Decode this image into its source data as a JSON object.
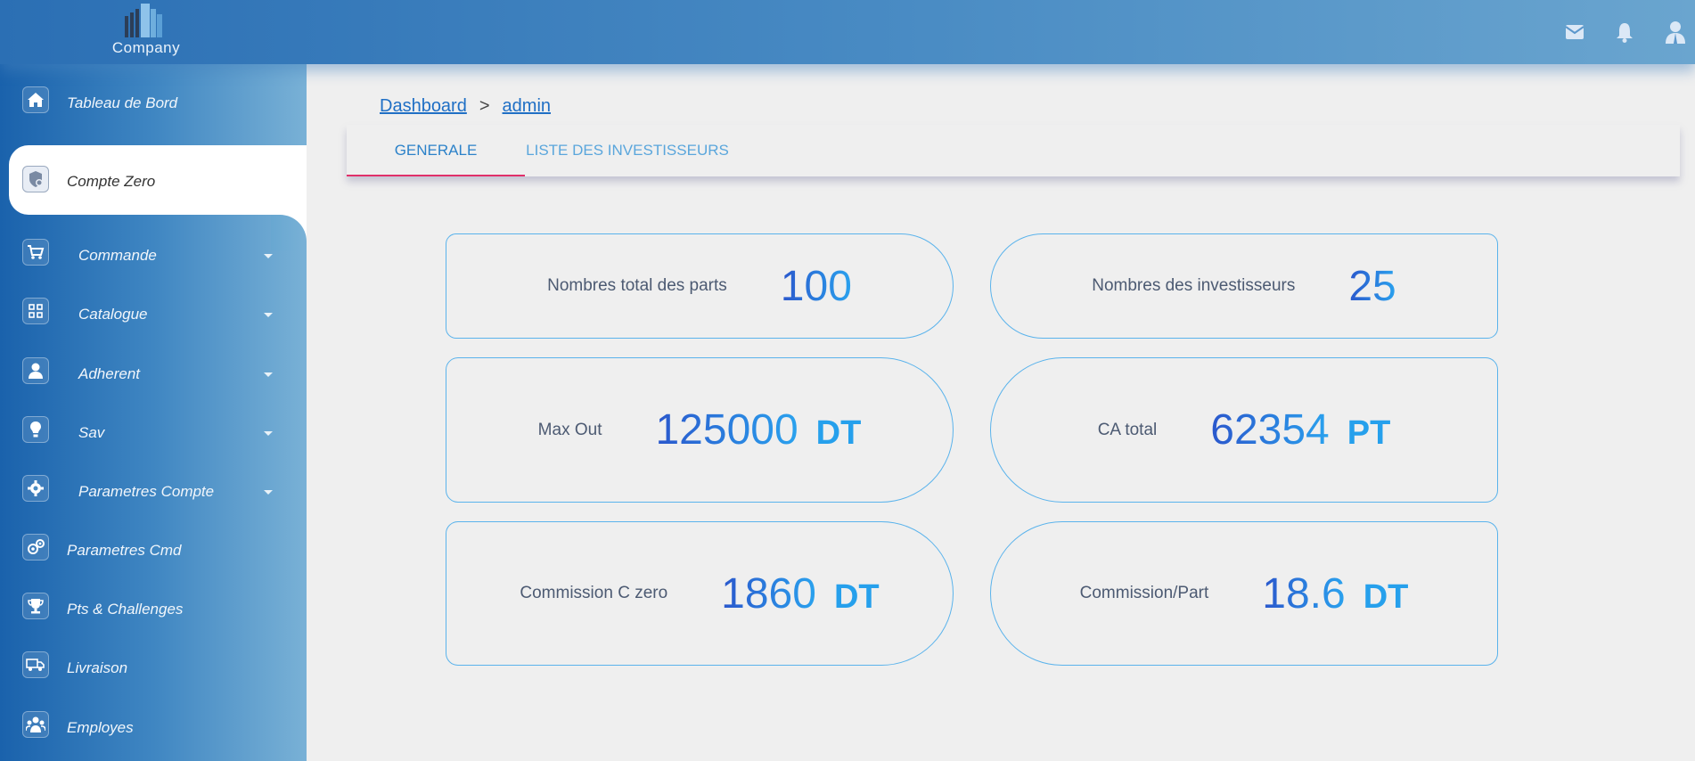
{
  "header": {
    "logo_text": "Company",
    "icons": [
      "mail-icon",
      "bell-icon",
      "user-icon"
    ]
  },
  "sidebar": {
    "items": [
      {
        "label": "Tableau de Bord",
        "icon": "home-icon",
        "has_caret": false
      },
      {
        "label": "Compte Zero",
        "icon": "shield-icon",
        "has_caret": false,
        "active": true
      },
      {
        "label": "Commande",
        "icon": "cart-icon",
        "has_caret": true
      },
      {
        "label": "Catalogue",
        "icon": "grid-icon",
        "has_caret": true
      },
      {
        "label": "Adherent",
        "icon": "person-icon",
        "has_caret": true
      },
      {
        "label": "Sav",
        "icon": "bulb-icon",
        "has_caret": true
      },
      {
        "label": "Parametres Compte",
        "icon": "gear-icon",
        "has_caret": true
      },
      {
        "label": "Parametres Cmd",
        "icon": "gears-icon",
        "has_caret": false
      },
      {
        "label": "Pts & Challenges",
        "icon": "trophy-icon",
        "has_caret": false
      },
      {
        "label": "Livraison",
        "icon": "truck-icon",
        "has_caret": false
      },
      {
        "label": "Employes",
        "icon": "team-icon",
        "has_caret": false
      }
    ]
  },
  "breadcrumb": {
    "root": "Dashboard",
    "separator": ">",
    "current": "admin"
  },
  "tabs": [
    {
      "label": "GENERALE",
      "active": true
    },
    {
      "label": "LISTE DES INVESTISSEURS",
      "active": false
    }
  ],
  "stats": [
    {
      "label": "Nombres total des parts",
      "value": "100",
      "unit": ""
    },
    {
      "label": "Nombres des investisseurs",
      "value": "25",
      "unit": ""
    },
    {
      "label": "Max Out",
      "value": "125000",
      "unit": "DT"
    },
    {
      "label": "CA total",
      "value": "62354",
      "unit": "PT"
    },
    {
      "label": "Commission C zero",
      "value": "1860",
      "unit": "DT"
    },
    {
      "label": "Commission/Part",
      "value": "18.6",
      "unit": "DT"
    }
  ],
  "colors": {
    "accent": "#2c82c9",
    "tab_indicator": "#e0306a",
    "card_border": "#5ab3ec"
  }
}
